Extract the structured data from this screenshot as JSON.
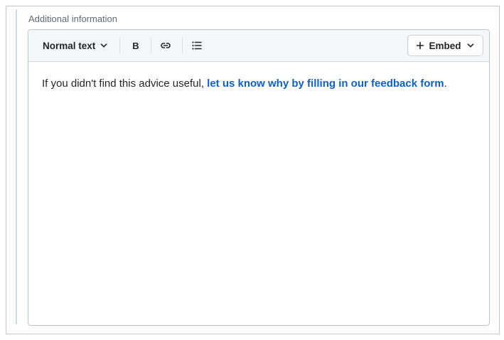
{
  "field": {
    "label": "Additional information"
  },
  "toolbar": {
    "text_style": {
      "selected": "Normal text",
      "icon": "chevron-down-icon"
    },
    "bold_label": "B",
    "link_icon": "link-icon",
    "list_icon": "bulleted-list-icon",
    "embed": {
      "label": "Embed",
      "icon": "plus-icon",
      "dropdown_icon": "chevron-down-icon"
    }
  },
  "content": {
    "text_before": "If you didn't find this advice useful, ",
    "link_text": "let us know why by filling in our feedback form",
    "text_after": "."
  },
  "colors": {
    "link": "#0f5fc7",
    "toolbar_bg": "#f4f7fa",
    "border": "#b9c6d2",
    "label": "#5f6b78"
  }
}
